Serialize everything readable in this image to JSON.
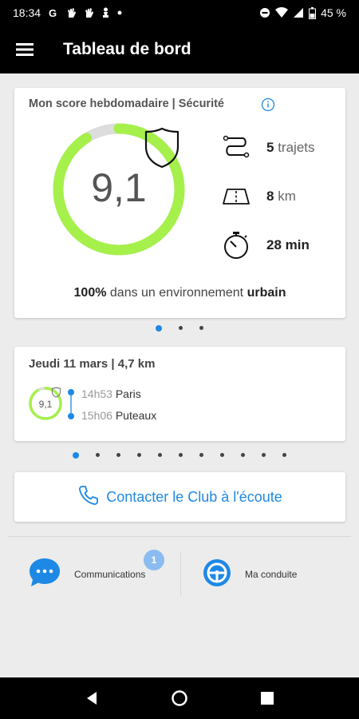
{
  "status_bar": {
    "time": "18:34",
    "left_icons": [
      "google-icon",
      "gesture-icon",
      "gesture-icon",
      "chess-pawn-icon",
      "dot-icon"
    ],
    "right_icons": [
      "dnd-icon",
      "wifi-icon",
      "signal-icon",
      "battery-icon"
    ],
    "battery": "45 %"
  },
  "app_bar": {
    "title": "Tableau de bord",
    "menu_icon": "hamburger-menu-icon"
  },
  "score_card": {
    "title": "Mon score hebdomadaire | Sécurité",
    "score": "9,1",
    "score_fraction": 0.91,
    "gauge_color": "#a5f04b",
    "gauge_track_color": "#dddddd",
    "stats": [
      {
        "icon": "route-icon",
        "value": "5",
        "unit": "trajets"
      },
      {
        "icon": "road-icon",
        "value": "8",
        "unit": "km"
      },
      {
        "icon": "stopwatch-icon",
        "value": "28 min",
        "unit": ""
      }
    ],
    "environment": {
      "percent": "100%",
      "text": "dans un environnement",
      "type": "urbain"
    }
  },
  "score_pager": {
    "count": 3,
    "active": 0
  },
  "trip_card": {
    "header": "Jeudi 11 mars | 4,7 km",
    "score": "9,1",
    "score_fraction": 0.91,
    "start": {
      "time": "14h53",
      "place": "Paris"
    },
    "end": {
      "time": "15h06",
      "place": "Puteaux"
    }
  },
  "trip_pager": {
    "count": 11,
    "active": 0
  },
  "contact": {
    "label": "Contacter le Club à l'écoute",
    "icon": "phone-icon"
  },
  "bottom_nav": {
    "communications": {
      "label": "Communications",
      "badge": "1",
      "icon": "chat-icon"
    },
    "driving": {
      "label": "Ma conduite",
      "icon": "steering-wheel-icon"
    }
  },
  "colors": {
    "accent": "#1e88e5",
    "gauge": "#a5f04b",
    "badge": "#8bbcf0"
  }
}
